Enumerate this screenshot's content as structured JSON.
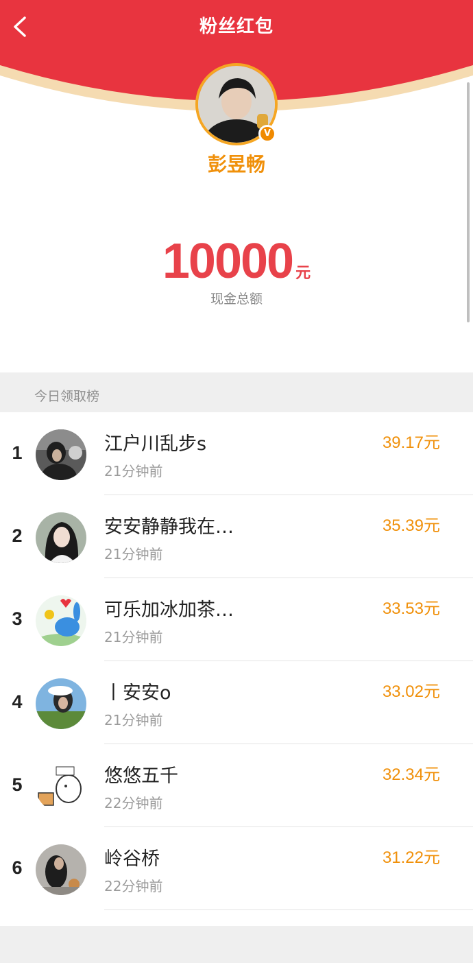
{
  "header": {
    "title": "粉丝红包",
    "back_icon": "chevron-left-icon",
    "bg_color": "#e8343f"
  },
  "profile": {
    "name": "彭昱畅",
    "badge": "V",
    "accent_color": "#f0900a"
  },
  "total": {
    "amount": "10000",
    "unit": "元",
    "caption": "现金总额",
    "color": "#e8424a"
  },
  "leaderboard": {
    "title": "今日领取榜",
    "rows": [
      {
        "rank": "1",
        "name": "江户川乱步s",
        "time": "21分钟前",
        "amount": "39.17元"
      },
      {
        "rank": "2",
        "name": "安安静静我在…",
        "time": "21分钟前",
        "amount": "35.39元"
      },
      {
        "rank": "3",
        "name": "可乐加冰加茶…",
        "time": "21分钟前",
        "amount": "33.53元"
      },
      {
        "rank": "4",
        "name": "丨安安o",
        "time": "21分钟前",
        "amount": "33.02元"
      },
      {
        "rank": "5",
        "name": "悠悠五千",
        "time": "22分钟前",
        "amount": "32.34元"
      },
      {
        "rank": "6",
        "name": "岭谷桥",
        "time": "22分钟前",
        "amount": "31.22元"
      }
    ]
  }
}
